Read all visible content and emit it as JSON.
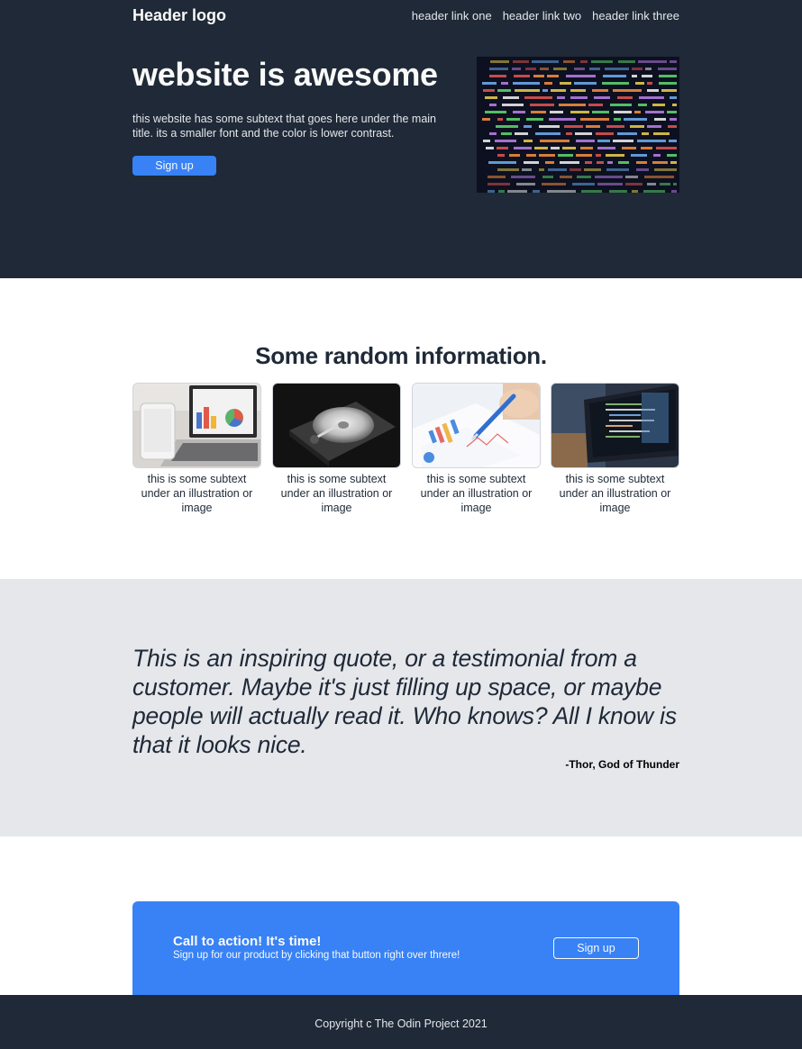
{
  "header": {
    "logo": "Header logo",
    "links": [
      "header link one",
      "header link two",
      "header link three"
    ]
  },
  "hero": {
    "title": "website is awesome",
    "subtext": "this website has some subtext that goes here under the main title. its a smaller font and the color is lower contrast.",
    "signup_label": "Sign up",
    "image": "code-screen-image"
  },
  "info": {
    "title": "Some random information.",
    "cards": [
      {
        "image": "laptop-charts-image",
        "caption": "this is some subtext under an illustration or image"
      },
      {
        "image": "hard-drive-image",
        "caption": "this is some subtext under an illustration or image"
      },
      {
        "image": "pen-charts-image",
        "caption": "this is some subtext under an illustration or image"
      },
      {
        "image": "laptop-code-image",
        "caption": "this is some subtext under an illustration or image"
      }
    ]
  },
  "quote": {
    "text": "This is an inspiring quote, or a testimonial from a customer. Maybe it's just filling up space, or maybe people will actually read it. Who knows? All I know is that it looks nice.",
    "author": "-Thor, God of Thunder"
  },
  "cta": {
    "title": "Call to action! It's time!",
    "subtext": "Sign up for our product by clicking that button right over threre!",
    "button_label": "Sign up"
  },
  "footer": {
    "copyright": "Copyright c The Odin Project 2021"
  },
  "colors": {
    "dark": "#1f2937",
    "accent": "#3882f6",
    "light_gray": "#e5e7eb",
    "off_white": "#f9faf8"
  }
}
